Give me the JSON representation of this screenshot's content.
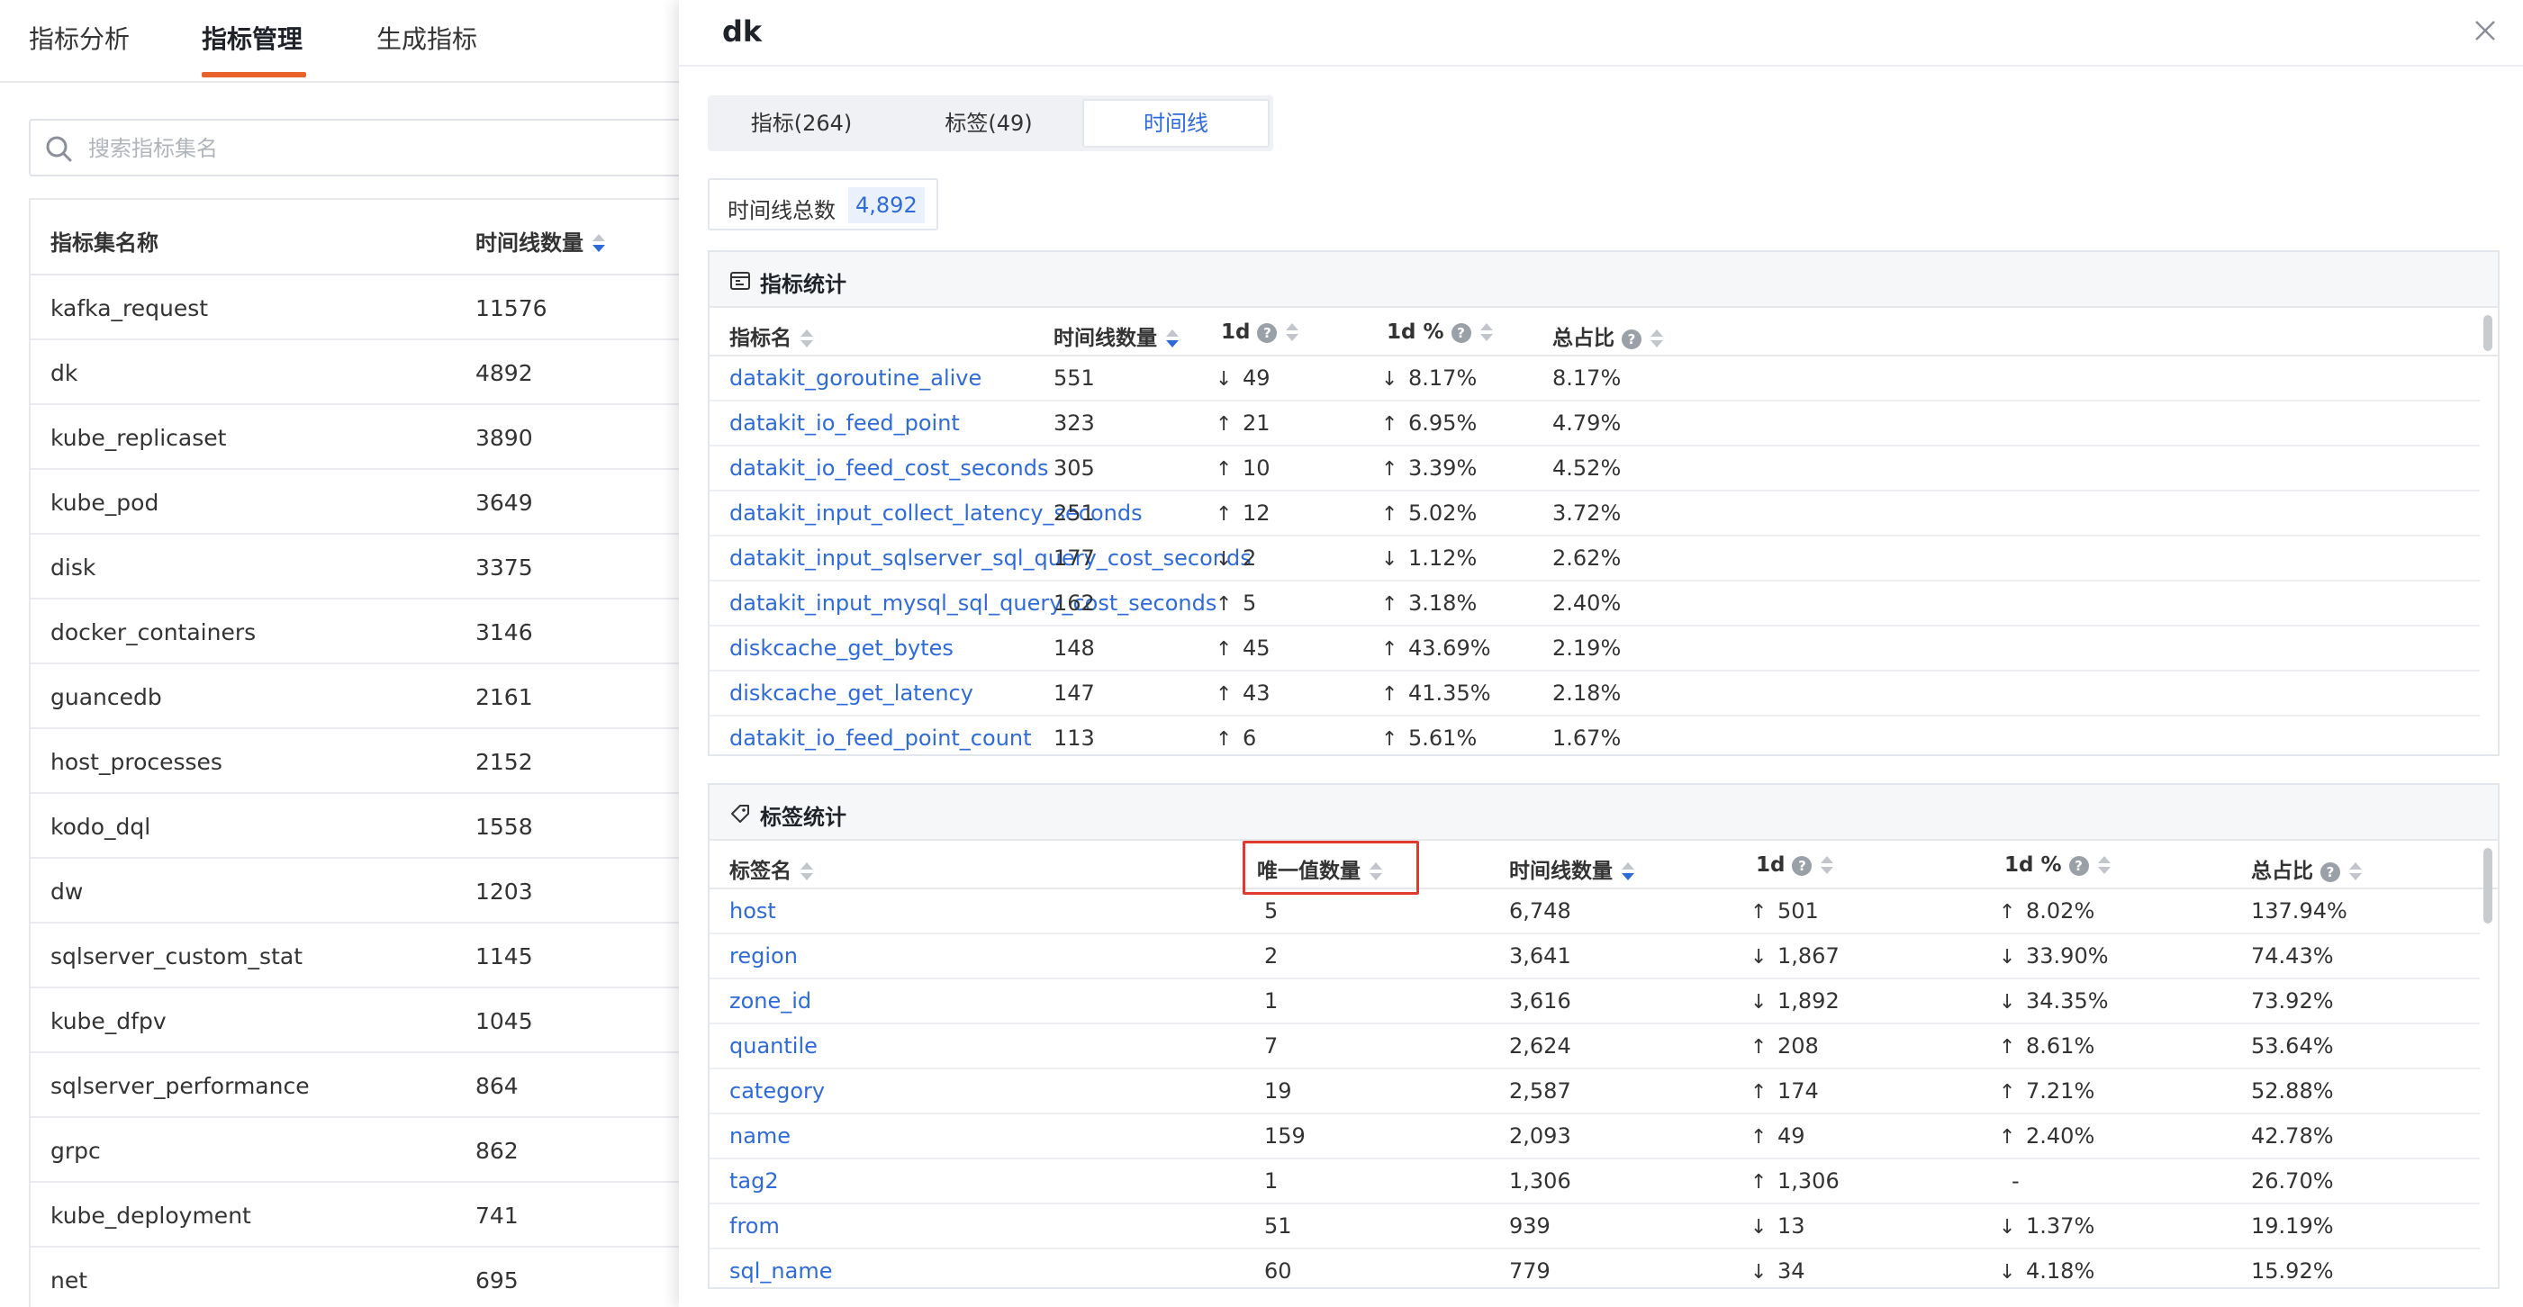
{
  "nav": {
    "tabs": [
      "指标分析",
      "指标管理",
      "生成指标"
    ],
    "active_index": 1,
    "accent": "#e8632b"
  },
  "search": {
    "placeholder": "搜索指标集名"
  },
  "left_table": {
    "headers": [
      "指标集名称",
      "时间线数量"
    ],
    "rows": [
      [
        "kafka_request",
        "11576"
      ],
      [
        "dk",
        "4892"
      ],
      [
        "kube_replicaset",
        "3890"
      ],
      [
        "kube_pod",
        "3649"
      ],
      [
        "disk",
        "3375"
      ],
      [
        "docker_containers",
        "3146"
      ],
      [
        "guancedb",
        "2161"
      ],
      [
        "host_processes",
        "2152"
      ],
      [
        "kodo_dql",
        "1558"
      ],
      [
        "dw",
        "1203"
      ],
      [
        "sqlserver_custom_stat",
        "1145"
      ],
      [
        "kube_dfpv",
        "1045"
      ],
      [
        "sqlserver_performance",
        "864"
      ],
      [
        "grpc",
        "862"
      ],
      [
        "kube_deployment",
        "741"
      ],
      [
        "net",
        "695"
      ]
    ]
  },
  "drawer": {
    "title": "dk",
    "tabs": [
      "指标(264)",
      "标签(49)",
      "时间线"
    ],
    "active_tab": 2,
    "total_label": "时间线总数",
    "total_value": "4,892",
    "colors": {
      "link": "#2f6bd8",
      "up": "#e5322d",
      "down": "#2fa34a",
      "highlight": "#e03a2c"
    }
  },
  "metric_stats": {
    "title": "指标统计",
    "headers": [
      "指标名",
      "时间线数量",
      "1d",
      "1d %",
      "总占比"
    ],
    "rows": [
      {
        "name": "datakit_goroutine_alive",
        "count": "551",
        "dir": "down",
        "d1": "49",
        "pct": "8.17%",
        "share": "8.17%"
      },
      {
        "name": "datakit_io_feed_point",
        "count": "323",
        "dir": "up",
        "d1": "21",
        "pct": "6.95%",
        "share": "4.79%"
      },
      {
        "name": "datakit_io_feed_cost_seconds",
        "count": "305",
        "dir": "up",
        "d1": "10",
        "pct": "3.39%",
        "share": "4.52%"
      },
      {
        "name": "datakit_input_collect_latency_seconds",
        "count": "251",
        "dir": "up",
        "d1": "12",
        "pct": "5.02%",
        "share": "3.72%"
      },
      {
        "name": "datakit_input_sqlserver_sql_query_cost_seconds",
        "count": "177",
        "dir": "down",
        "d1": "2",
        "pct": "1.12%",
        "share": "2.62%"
      },
      {
        "name": "datakit_input_mysql_sql_query_cost_seconds",
        "count": "162",
        "dir": "up",
        "d1": "5",
        "pct": "3.18%",
        "share": "2.40%"
      },
      {
        "name": "diskcache_get_bytes",
        "count": "148",
        "dir": "up",
        "d1": "45",
        "pct": "43.69%",
        "share": "2.19%"
      },
      {
        "name": "diskcache_get_latency",
        "count": "147",
        "dir": "up",
        "d1": "43",
        "pct": "41.35%",
        "share": "2.18%"
      },
      {
        "name": "datakit_io_feed_point_count",
        "count": "113",
        "dir": "up",
        "d1": "6",
        "pct": "5.61%",
        "share": "1.67%"
      }
    ]
  },
  "tag_stats": {
    "title": "标签统计",
    "headers": [
      "标签名",
      "唯一值数量",
      "时间线数量",
      "1d",
      "1d %",
      "总占比"
    ],
    "rows": [
      {
        "name": "host",
        "uniq": "5",
        "count": "6,748",
        "dir": "up",
        "d1": "501",
        "pct": "8.02%",
        "share": "137.94%"
      },
      {
        "name": "region",
        "uniq": "2",
        "count": "3,641",
        "dir": "down",
        "d1": "1,867",
        "pct": "33.90%",
        "share": "74.43%"
      },
      {
        "name": "zone_id",
        "uniq": "1",
        "count": "3,616",
        "dir": "down",
        "d1": "1,892",
        "pct": "34.35%",
        "share": "73.92%"
      },
      {
        "name": "quantile",
        "uniq": "7",
        "count": "2,624",
        "dir": "up",
        "d1": "208",
        "pct": "8.61%",
        "share": "53.64%"
      },
      {
        "name": "category",
        "uniq": "19",
        "count": "2,587",
        "dir": "up",
        "d1": "174",
        "pct": "7.21%",
        "share": "52.88%"
      },
      {
        "name": "name",
        "uniq": "159",
        "count": "2,093",
        "dir": "up",
        "d1": "49",
        "pct": "2.40%",
        "share": "42.78%"
      },
      {
        "name": "tag2",
        "uniq": "1",
        "count": "1,306",
        "dir": "up",
        "d1": "1,306",
        "pct": "-",
        "share": "26.70%"
      },
      {
        "name": "from",
        "uniq": "51",
        "count": "939",
        "dir": "down",
        "d1": "13",
        "pct": "1.37%",
        "share": "19.19%"
      },
      {
        "name": "sql_name",
        "uniq": "60",
        "count": "779",
        "dir": "down",
        "d1": "34",
        "pct": "4.18%",
        "share": "15.92%"
      }
    ]
  },
  "icons": [
    "search-icon",
    "close-icon",
    "chart-icon",
    "tag-icon",
    "sort-icon",
    "help-icon",
    "arrow-up-icon",
    "arrow-down-icon"
  ]
}
